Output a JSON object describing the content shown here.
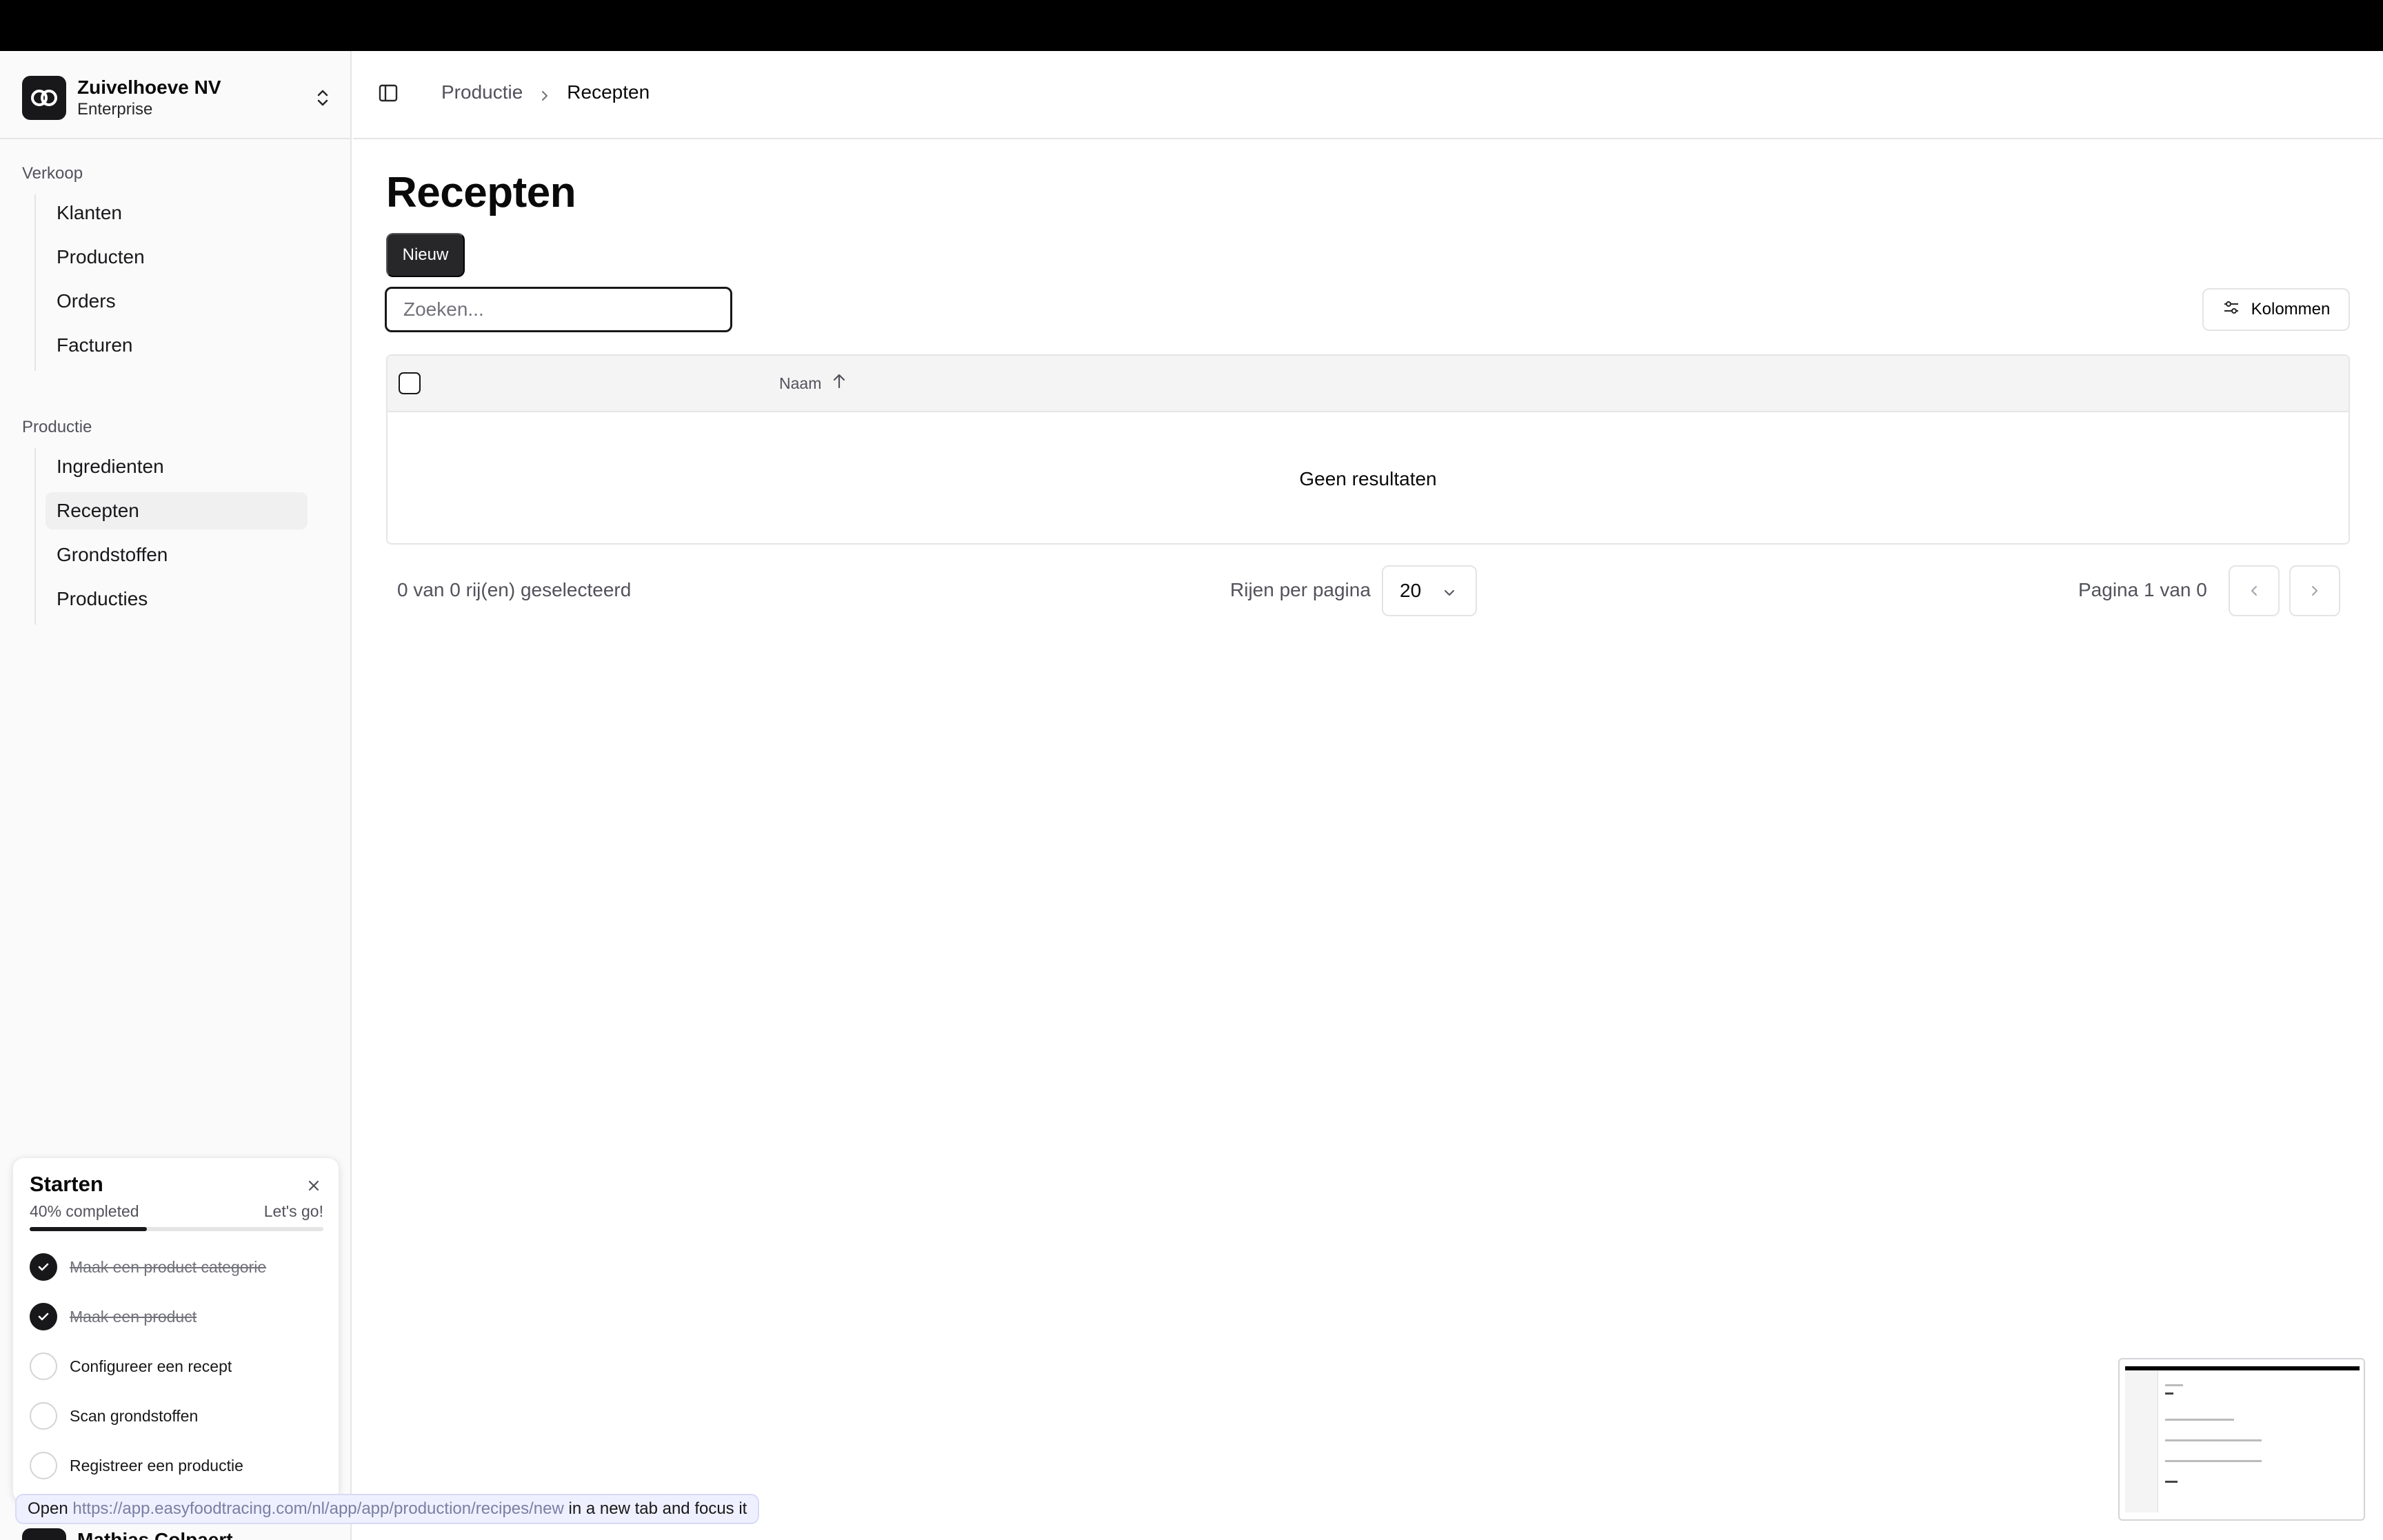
{
  "org": {
    "name": "Zuivelhoeve NV",
    "plan": "Enterprise"
  },
  "sidebar": {
    "groups": [
      {
        "label": "Verkoop",
        "items": [
          {
            "label": "Klanten"
          },
          {
            "label": "Producten"
          },
          {
            "label": "Orders"
          },
          {
            "label": "Facturen"
          }
        ]
      },
      {
        "label": "Productie",
        "items": [
          {
            "label": "Ingredienten"
          },
          {
            "label": "Recepten",
            "active": true
          },
          {
            "label": "Grondstoffen"
          },
          {
            "label": "Producties"
          }
        ]
      }
    ]
  },
  "starter": {
    "title": "Starten",
    "progress_label": "40% completed",
    "progress": 0.4,
    "go_label": "Let's go!",
    "tasks": [
      {
        "label": "Maak een product categorie",
        "done": true
      },
      {
        "label": "Maak een product",
        "done": true
      },
      {
        "label": "Configureer een recept",
        "done": false
      },
      {
        "label": "Scan grondstoffen",
        "done": false
      },
      {
        "label": "Registreer een productie",
        "done": false
      }
    ]
  },
  "user": {
    "name": "Mathias Colpaert"
  },
  "status_tip": {
    "prefix": "Open",
    "url": "https://app.easyfoodtracing.com/nl/app/app/production/recipes/new",
    "suffix": "in a new tab and focus it"
  },
  "breadcrumb": {
    "parent": "Productie",
    "current": "Recepten"
  },
  "page": {
    "title": "Recepten",
    "new_button": "Nieuw",
    "search_placeholder": "Zoeken...",
    "columns_button": "Kolommen"
  },
  "table": {
    "columns": [
      {
        "label": "Naam",
        "sort": "asc"
      }
    ],
    "empty_text": "Geen resultaten"
  },
  "footer": {
    "selection": "0 van 0 rij(en) geselecteerd",
    "rows_per_page_label": "Rijen per pagina",
    "rows_per_page_value": "20",
    "page_label": "Pagina 1 van 0"
  },
  "colors": {
    "primary": "#18181b",
    "sidebar_bg": "#fafafa",
    "border": "#e5e5e5"
  },
  "icons": [
    "org-logo-icon",
    "chevrons-up-down-icon",
    "sidebar-toggle-icon",
    "chevron-right-icon",
    "sliders-icon",
    "arrow-up-icon",
    "chevron-down-icon",
    "chevron-left-icon",
    "check-icon",
    "close-icon"
  ]
}
